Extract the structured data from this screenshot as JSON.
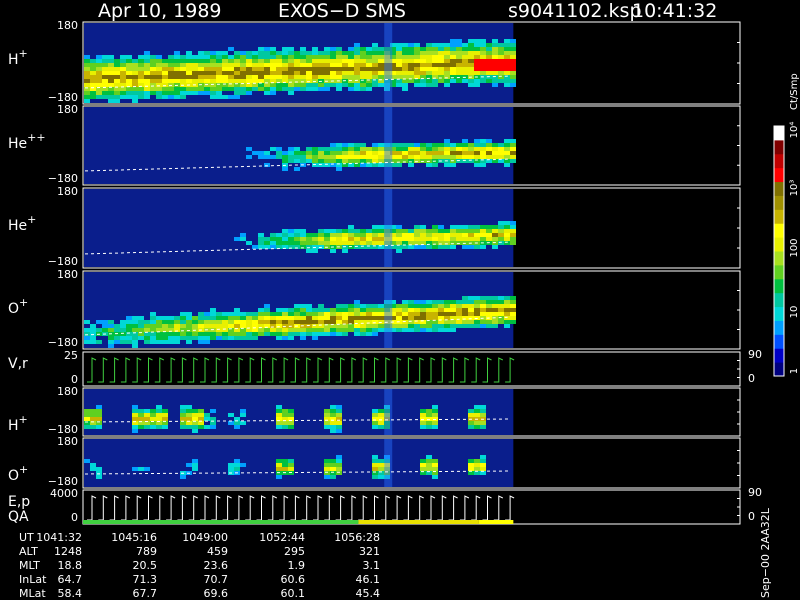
{
  "header": {
    "date": "Apr 10, 1989",
    "instrument": "EXOS−D SMS",
    "file": "s9041102.ksp",
    "time": "10:41:32"
  },
  "chart_data": {
    "type": "heatmap",
    "panels": [
      {
        "label": "H",
        "sup": "+",
        "ytop": "180",
        "ybot": "−180",
        "ymin": -180,
        "ymax": 180
      },
      {
        "label": "He",
        "sup": "++",
        "ytop": "180",
        "ybot": "−180",
        "ymin": -180,
        "ymax": 180
      },
      {
        "label": "He",
        "sup": "+",
        "ytop": "180",
        "ybot": "−180",
        "ymin": -180,
        "ymax": 180
      },
      {
        "label": "O",
        "sup": "+",
        "ytop": "180",
        "ybot": "−180",
        "ymin": -180,
        "ymax": 180
      },
      {
        "label": "V,r",
        "sup": "",
        "ytop": "25",
        "ybot": "0",
        "rtop": "90",
        "rbot": "0"
      },
      {
        "label": "H",
        "sup": "+",
        "ytop": "180",
        "ybot": "−180",
        "ymin": -180,
        "ymax": 180
      },
      {
        "label": "O",
        "sup": "+",
        "ytop": "180",
        "ybot": "−180",
        "ymin": -180,
        "ymax": 180
      },
      {
        "label": "E,p",
        "label2": "QA",
        "sup": "",
        "ytop": "4000",
        "ybot": "0",
        "rtop": "90",
        "rbot": "0"
      }
    ],
    "colorbar": {
      "unit": "Ct/Smp",
      "ticks": [
        "1",
        "10",
        "100",
        "10³",
        "10⁴"
      ],
      "colors": [
        "#000080",
        "#0000c8",
        "#0050ff",
        "#00a0ff",
        "#00d8d8",
        "#00c8a0",
        "#00c040",
        "#60d020",
        "#a8e020",
        "#e8f000",
        "#ffff00",
        "#c8b400",
        "#a09000",
        "#807000",
        "#ff0000",
        "#c00000",
        "#800000",
        "#ffffff"
      ]
    },
    "x_axis": {
      "rows": [
        "UT",
        "ALT",
        "MLT",
        "InLat",
        "MLat"
      ],
      "times": [
        "1041:32",
        "1045:16",
        "1049:00",
        "1052:44",
        "1056:28"
      ],
      "ALT": [
        "1248",
        "789",
        "459",
        "295",
        "321"
      ],
      "MLT": [
        "18.8",
        "20.5",
        "23.6",
        "1.9",
        "3.1"
      ],
      "InLat": [
        "64.7",
        "71.3",
        "70.7",
        "60.6",
        "46.1"
      ],
      "MLat": [
        "58.4",
        "67.7",
        "69.6",
        "60.1",
        "45.4"
      ],
      "data_coverage": 0.655
    },
    "side_label": "Sep−00  2AA32L"
  }
}
